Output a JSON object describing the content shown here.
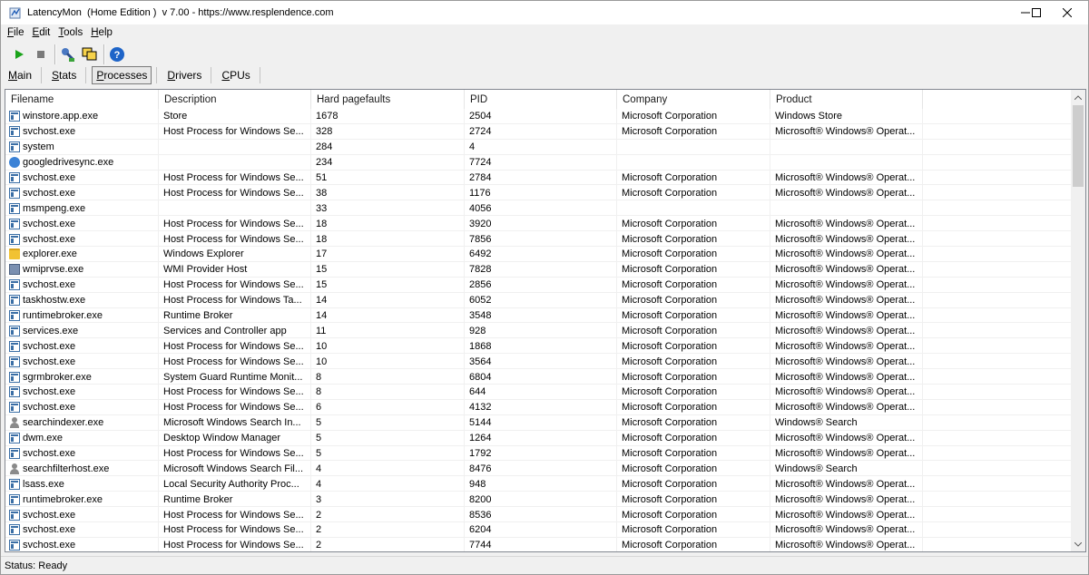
{
  "window": {
    "title": "LatencyMon  (Home Edition )  v 7.00 - https://www.resplendence.com"
  },
  "menu": [
    {
      "mnemonic": "F",
      "rest": "ile"
    },
    {
      "mnemonic": "E",
      "rest": "dit"
    },
    {
      "mnemonic": "T",
      "rest": "ools"
    },
    {
      "mnemonic": "H",
      "rest": "elp"
    }
  ],
  "toolbar": {
    "icons": [
      "play-icon",
      "stop-icon",
      "analyze-icon",
      "windows-icon",
      "help-icon"
    ]
  },
  "tabs": [
    {
      "mnemonic": "M",
      "rest": "ain",
      "active": false
    },
    {
      "mnemonic": "S",
      "rest": "tats",
      "active": false
    },
    {
      "mnemonic": "P",
      "rest": "rocesses",
      "active": true
    },
    {
      "mnemonic": "D",
      "rest": "rivers",
      "active": false
    },
    {
      "mnemonic": "C",
      "rest": "PUs",
      "active": false
    }
  ],
  "table": {
    "columns": [
      "Filename",
      "Description",
      "Hard pagefaults",
      "PID",
      "Company",
      "Product"
    ],
    "rows": [
      {
        "icon": "exe",
        "filename": "winstore.app.exe",
        "description": "Store",
        "hpf": "1678",
        "pid": "2504",
        "company": "Microsoft Corporation",
        "product": "Windows Store"
      },
      {
        "icon": "exe",
        "filename": "svchost.exe",
        "description": "Host Process for Windows Se...",
        "hpf": "328",
        "pid": "2724",
        "company": "Microsoft Corporation",
        "product": "Microsoft® Windows® Operat..."
      },
      {
        "icon": "exe",
        "filename": "system",
        "description": "",
        "hpf": "284",
        "pid": "4",
        "company": "",
        "product": ""
      },
      {
        "icon": "gdrive",
        "filename": "googledrivesync.exe",
        "description": "",
        "hpf": "234",
        "pid": "7724",
        "company": "",
        "product": ""
      },
      {
        "icon": "exe",
        "filename": "svchost.exe",
        "description": "Host Process for Windows Se...",
        "hpf": "51",
        "pid": "2784",
        "company": "Microsoft Corporation",
        "product": "Microsoft® Windows® Operat..."
      },
      {
        "icon": "exe",
        "filename": "svchost.exe",
        "description": "Host Process for Windows Se...",
        "hpf": "38",
        "pid": "1176",
        "company": "Microsoft Corporation",
        "product": "Microsoft® Windows® Operat..."
      },
      {
        "icon": "exe",
        "filename": "msmpeng.exe",
        "description": "",
        "hpf": "33",
        "pid": "4056",
        "company": "",
        "product": ""
      },
      {
        "icon": "exe",
        "filename": "svchost.exe",
        "description": "Host Process for Windows Se...",
        "hpf": "18",
        "pid": "3920",
        "company": "Microsoft Corporation",
        "product": "Microsoft® Windows® Operat..."
      },
      {
        "icon": "exe",
        "filename": "svchost.exe",
        "description": "Host Process for Windows Se...",
        "hpf": "18",
        "pid": "7856",
        "company": "Microsoft Corporation",
        "product": "Microsoft® Windows® Operat..."
      },
      {
        "icon": "folder",
        "filename": "explorer.exe",
        "description": "Windows Explorer",
        "hpf": "17",
        "pid": "6492",
        "company": "Microsoft Corporation",
        "product": "Microsoft® Windows® Operat..."
      },
      {
        "icon": "wmi",
        "filename": "wmiprvse.exe",
        "description": "WMI Provider Host",
        "hpf": "15",
        "pid": "7828",
        "company": "Microsoft Corporation",
        "product": "Microsoft® Windows® Operat..."
      },
      {
        "icon": "exe",
        "filename": "svchost.exe",
        "description": "Host Process for Windows Se...",
        "hpf": "15",
        "pid": "2856",
        "company": "Microsoft Corporation",
        "product": "Microsoft® Windows® Operat..."
      },
      {
        "icon": "exe",
        "filename": "taskhostw.exe",
        "description": "Host Process for Windows Ta...",
        "hpf": "14",
        "pid": "6052",
        "company": "Microsoft Corporation",
        "product": "Microsoft® Windows® Operat..."
      },
      {
        "icon": "exe",
        "filename": "runtimebroker.exe",
        "description": "Runtime Broker",
        "hpf": "14",
        "pid": "3548",
        "company": "Microsoft Corporation",
        "product": "Microsoft® Windows® Operat..."
      },
      {
        "icon": "exe",
        "filename": "services.exe",
        "description": "Services and Controller app",
        "hpf": "11",
        "pid": "928",
        "company": "Microsoft Corporation",
        "product": "Microsoft® Windows® Operat..."
      },
      {
        "icon": "exe",
        "filename": "svchost.exe",
        "description": "Host Process for Windows Se...",
        "hpf": "10",
        "pid": "1868",
        "company": "Microsoft Corporation",
        "product": "Microsoft® Windows® Operat..."
      },
      {
        "icon": "exe",
        "filename": "svchost.exe",
        "description": "Host Process for Windows Se...",
        "hpf": "10",
        "pid": "3564",
        "company": "Microsoft Corporation",
        "product": "Microsoft® Windows® Operat..."
      },
      {
        "icon": "exe",
        "filename": "sgrmbroker.exe",
        "description": "System Guard Runtime Monit...",
        "hpf": "8",
        "pid": "6804",
        "company": "Microsoft Corporation",
        "product": "Microsoft® Windows® Operat..."
      },
      {
        "icon": "exe",
        "filename": "svchost.exe",
        "description": "Host Process for Windows Se...",
        "hpf": "8",
        "pid": "644",
        "company": "Microsoft Corporation",
        "product": "Microsoft® Windows® Operat..."
      },
      {
        "icon": "exe",
        "filename": "svchost.exe",
        "description": "Host Process for Windows Se...",
        "hpf": "6",
        "pid": "4132",
        "company": "Microsoft Corporation",
        "product": "Microsoft® Windows® Operat..."
      },
      {
        "icon": "person",
        "filename": "searchindexer.exe",
        "description": "Microsoft Windows Search In...",
        "hpf": "5",
        "pid": "5144",
        "company": "Microsoft Corporation",
        "product": "Windows® Search"
      },
      {
        "icon": "exe",
        "filename": "dwm.exe",
        "description": "Desktop Window Manager",
        "hpf": "5",
        "pid": "1264",
        "company": "Microsoft Corporation",
        "product": "Microsoft® Windows® Operat..."
      },
      {
        "icon": "exe",
        "filename": "svchost.exe",
        "description": "Host Process for Windows Se...",
        "hpf": "5",
        "pid": "1792",
        "company": "Microsoft Corporation",
        "product": "Microsoft® Windows® Operat..."
      },
      {
        "icon": "person",
        "filename": "searchfilterhost.exe",
        "description": "Microsoft Windows Search Fil...",
        "hpf": "4",
        "pid": "8476",
        "company": "Microsoft Corporation",
        "product": "Windows® Search"
      },
      {
        "icon": "exe",
        "filename": "lsass.exe",
        "description": "Local Security Authority Proc...",
        "hpf": "4",
        "pid": "948",
        "company": "Microsoft Corporation",
        "product": "Microsoft® Windows® Operat..."
      },
      {
        "icon": "exe",
        "filename": "runtimebroker.exe",
        "description": "Runtime Broker",
        "hpf": "3",
        "pid": "8200",
        "company": "Microsoft Corporation",
        "product": "Microsoft® Windows® Operat..."
      },
      {
        "icon": "exe",
        "filename": "svchost.exe",
        "description": "Host Process for Windows Se...",
        "hpf": "2",
        "pid": "8536",
        "company": "Microsoft Corporation",
        "product": "Microsoft® Windows® Operat..."
      },
      {
        "icon": "exe",
        "filename": "svchost.exe",
        "description": "Host Process for Windows Se...",
        "hpf": "2",
        "pid": "6204",
        "company": "Microsoft Corporation",
        "product": "Microsoft® Windows® Operat..."
      },
      {
        "icon": "exe",
        "filename": "svchost.exe",
        "description": "Host Process for Windows Se...",
        "hpf": "2",
        "pid": "7744",
        "company": "Microsoft Corporation",
        "product": "Microsoft® Windows® Operat..."
      }
    ]
  },
  "status": {
    "text": "Status: Ready"
  },
  "colors": {
    "play": "#1aa31a",
    "stop": "#7a7a7a",
    "help": "#1e64c8"
  }
}
